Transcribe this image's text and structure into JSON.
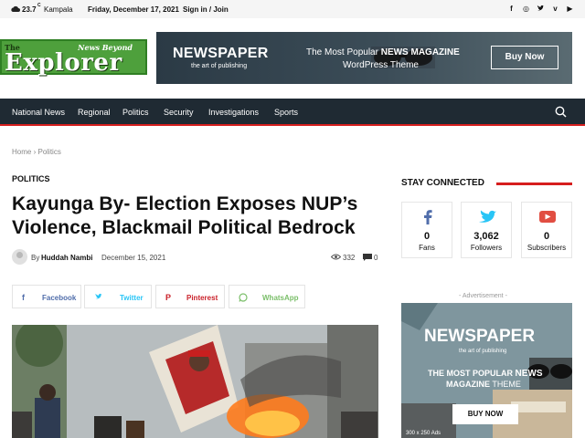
{
  "topbar": {
    "weather_icon": "cloud-icon",
    "temperature": "23.7",
    "temperature_unit": "C",
    "location": "Kampala",
    "date": "Friday, December 17, 2021",
    "signin": "Sign in / Join",
    "social": [
      {
        "icon": "facebook-icon",
        "glyph": "f"
      },
      {
        "icon": "instagram-icon",
        "glyph": "◎"
      },
      {
        "icon": "twitter-icon",
        "glyph": "♥"
      },
      {
        "icon": "vimeo-icon",
        "glyph": "v"
      },
      {
        "icon": "youtube-icon",
        "glyph": "▶"
      }
    ]
  },
  "logo": {
    "the": "The",
    "tagline": "News Beyond",
    "name": "Explorer"
  },
  "banner": {
    "brand": "NEWSPAPER",
    "brand_tag": "the art of publishing",
    "line1_prefix": "The Most Popular ",
    "line1_bold": "NEWS MAGAZINE",
    "line2": "WordPress Theme",
    "cta": "Buy Now"
  },
  "nav": {
    "items": [
      "National News",
      "Regional",
      "Politics",
      "Security",
      "Investigations",
      "Sports"
    ],
    "search_icon": "search-icon"
  },
  "breadcrumb": {
    "home": "Home",
    "separator": "›",
    "current": "Politics"
  },
  "article": {
    "category": "POLITICS",
    "title": "Kayunga By- Election Exposes NUP’s Violence, Blackmail Political Bedrock",
    "by": "By",
    "author": "Huddah Nambi",
    "date": "December 15, 2021",
    "views": "332",
    "comments": "0"
  },
  "share": [
    {
      "label": "Facebook",
      "icon": "facebook-icon",
      "glyph": "f",
      "color": "#516eab"
    },
    {
      "label": "Twitter",
      "icon": "twitter-icon",
      "glyph": "🐦",
      "color": "#29c5f6"
    },
    {
      "label": "Pinterest",
      "icon": "pinterest-icon",
      "glyph": "P",
      "color": "#ca212a"
    },
    {
      "label": "WhatsApp",
      "icon": "whatsapp-icon",
      "glyph": "◯",
      "color": "#7bbf6a"
    }
  ],
  "sidebar": {
    "stay_connected": "STAY CONNECTED",
    "accent": "#d61e1e",
    "socials": [
      {
        "icon": "facebook-icon",
        "count": "0",
        "label": "Fans",
        "color": "#516eab"
      },
      {
        "icon": "twitter-icon",
        "count": "3,062",
        "label": "Followers",
        "color": "#29c5f6"
      },
      {
        "icon": "youtube-icon",
        "count": "0",
        "label": "Subscribers",
        "color": "#e14e42"
      }
    ],
    "ad_label": "- Advertisement -",
    "ad": {
      "brand": "NEWSPAPER",
      "brand_tag": "the art of publishing",
      "line1_prefix": "THE MOST POPULAR ",
      "line1_bold": "NEWS",
      "line2_bold": "MAGAZINE",
      "line2_rest": " THEME",
      "cta": "BUY NOW",
      "sub": "300 x 250 Ads"
    }
  }
}
